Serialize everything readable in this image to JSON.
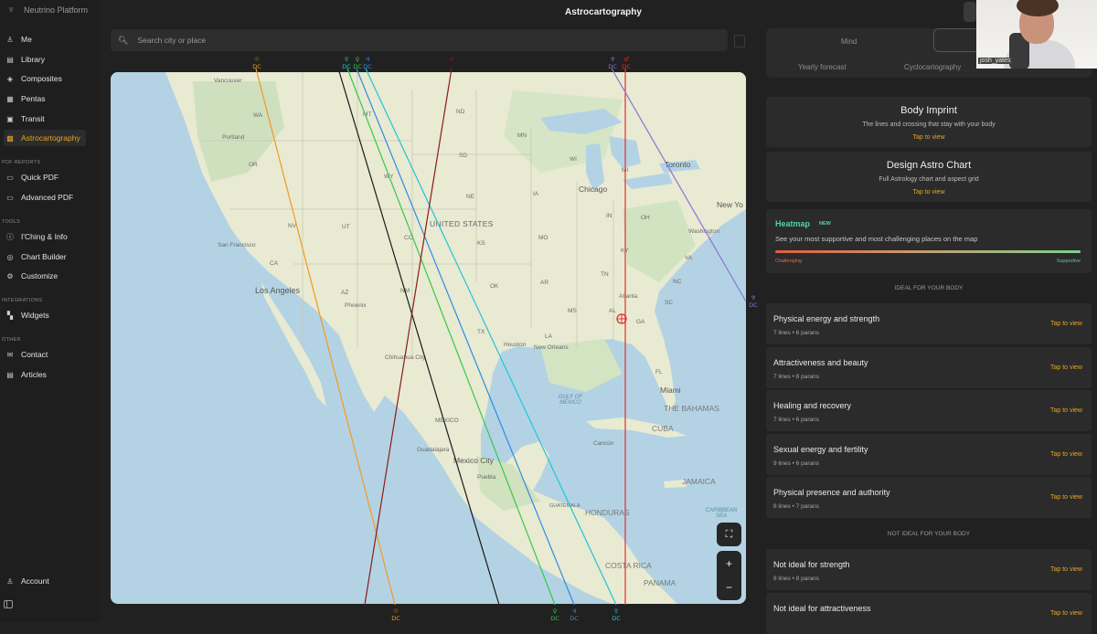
{
  "app": {
    "brand": "Neutrino Platform",
    "title": "Astrocartography"
  },
  "sidebar": {
    "items": [
      {
        "label": "Me",
        "icon": "person-icon"
      },
      {
        "label": "Library",
        "icon": "book-icon"
      },
      {
        "label": "Composites",
        "icon": "composites-icon"
      },
      {
        "label": "Pentas",
        "icon": "grid-icon"
      },
      {
        "label": "Transit",
        "icon": "transit-icon"
      },
      {
        "label": "Astrocartography",
        "icon": "map-icon",
        "active": true
      }
    ],
    "sections": [
      {
        "label": "PDF REPORTS",
        "items": [
          {
            "label": "Quick PDF"
          },
          {
            "label": "Advanced PDF"
          }
        ]
      },
      {
        "label": "TOOLS",
        "items": [
          {
            "label": "I'Ching & Info"
          },
          {
            "label": "Chart Builder"
          },
          {
            "label": "Customize"
          }
        ]
      },
      {
        "label": "INTEGRATIONS",
        "items": [
          {
            "label": "Widgets"
          }
        ]
      },
      {
        "label": "OTHER",
        "items": [
          {
            "label": "Contact"
          },
          {
            "label": "Articles"
          }
        ]
      }
    ],
    "account": "Account"
  },
  "search": {
    "placeholder": "Search city or place"
  },
  "map": {
    "labels": {
      "vancouver": "Vancouver",
      "wa": "WA",
      "portland": "Portland",
      "or": "OR",
      "nv": "NV",
      "san_francisco": "San Francisco",
      "ca": "CA",
      "los_angeles": "Los Angeles",
      "az": "AZ",
      "phoenix": "Phoenix",
      "ut": "UT",
      "mt": "MT",
      "wy": "WY",
      "co": "CO",
      "nm": "NM",
      "nd": "ND",
      "sd": "SD",
      "ne": "NE",
      "ks": "KS",
      "ok": "OK",
      "tx": "TX",
      "united_states": "UNITED STATES",
      "mn": "MN",
      "ia": "IA",
      "mo": "MO",
      "ar": "AR",
      "la": "LA",
      "ms": "MS",
      "wi": "WI",
      "mi": "MI",
      "chicago": "Chicago",
      "in": "IN",
      "oh": "OH",
      "ky": "KY",
      "tn": "TN",
      "al": "AL",
      "ga": "GA",
      "sc": "SC",
      "nc": "NC",
      "va": "VA",
      "fl": "FL",
      "toronto": "Toronto",
      "new_york": "New Yo",
      "washington": "Washington",
      "atlanta": "Atlanta",
      "houston": "Houston",
      "new_orleans": "New Orleans",
      "miami": "Miami",
      "chihuahua": "Chihuahua City",
      "mexico": "MEXICO",
      "guadalajara": "Guadalajara",
      "mexico_city": "Mexico City",
      "puebla": "Puebla",
      "gulf": "GULF OF MEXICO",
      "bahamas": "THE BAHAMAS",
      "cuba": "CUBA",
      "cancun": "Cancún",
      "jamaica": "JAMAICA",
      "guatemala": "GUATEMALA",
      "honduras": "HONDURAS",
      "caribbean": "CARIBBEAN SEA",
      "costa_rica": "COSTA RICA",
      "panama": "PANAMA"
    },
    "line_tag": "DC",
    "line_colors": {
      "orange": "#f39a1e",
      "black": "#1a1a1a",
      "green": "#35c94a",
      "cyan": "#21c4d9",
      "blue": "#2f8be3",
      "darkred": "#8b1a1a",
      "red": "#e03030",
      "purple": "#8a72d8"
    },
    "controls": {
      "fullscreen": "⛶",
      "zoom_in": "+",
      "zoom_out": "−"
    }
  },
  "tabs": {
    "mind": "Mind",
    "yearly": "Yearly forecast",
    "cyclo": "Cyclocartography"
  },
  "cards": [
    {
      "title": "Body Imprint",
      "subtitle": "The lines and crossing that stay with your body",
      "tap": "Tap to view"
    },
    {
      "title": "Design Astro Chart",
      "subtitle": "Full Astrology chart and aspect grid",
      "tap": "Tap to view"
    }
  ],
  "heatmap": {
    "title": "Heatmap",
    "badge": "NEW",
    "description": "See your most supportive and most challenging places on the map",
    "low": "Challenging",
    "high": "Supportive"
  },
  "ideal": {
    "heading": "IDEAL FOR YOUR BODY",
    "rows": [
      {
        "title": "Physical energy and strength",
        "meta": "7 lines • 6 parans",
        "action": "Tap to view"
      },
      {
        "title": "Attractiveness and beauty",
        "meta": "7 lines • 8 parans",
        "action": "Tap to view"
      },
      {
        "title": "Healing and recovery",
        "meta": "7 lines • 6 parans",
        "action": "Tap to view"
      },
      {
        "title": "Sexual energy and fertility",
        "meta": "9 lines • 6 parans",
        "action": "Tap to view"
      },
      {
        "title": "Physical presence and authority",
        "meta": "8 lines • 7 parans",
        "action": "Tap to view"
      }
    ]
  },
  "not_ideal": {
    "heading": "NOT IDEAL FOR YOUR BODY",
    "rows": [
      {
        "title": "Not ideal for strength",
        "meta": "8 lines • 8 parans",
        "action": "Tap to view"
      },
      {
        "title": "Not ideal for attractiveness",
        "action": "Tap to view"
      }
    ]
  },
  "webcam": {
    "name": "josh_yates"
  }
}
